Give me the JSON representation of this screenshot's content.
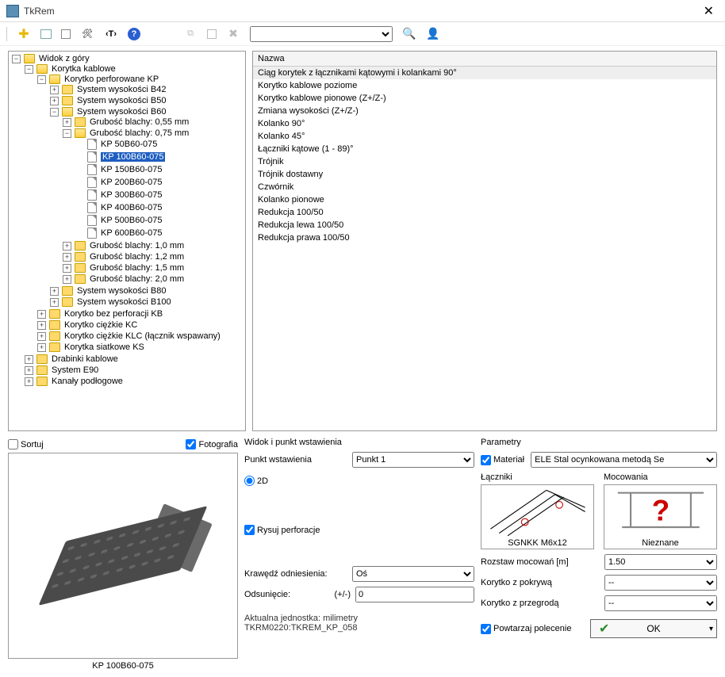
{
  "window": {
    "title": "TkRem"
  },
  "toolbar": {
    "search_value": ""
  },
  "tree": {
    "root_label": "Widok z góry",
    "korytka_label": "Korytka kablowe",
    "kp_label": "Korytko perforowane KP",
    "b42": "System wysokości B42",
    "b50": "System wysokości B50",
    "b60": "System wysokości B60",
    "gb055": "Grubość blachy: 0,55 mm",
    "gb075": "Grubość blachy: 0,75 mm",
    "kp50": "KP 50B60-075",
    "kp100": "KP 100B60-075",
    "kp150": "KP 150B60-075",
    "kp200": "KP 200B60-075",
    "kp300": "KP 300B60-075",
    "kp400": "KP 400B60-075",
    "kp500": "KP 500B60-075",
    "kp600": "KP 600B60-075",
    "gb10": "Grubość blachy: 1,0 mm",
    "gb12": "Grubość blachy: 1,2 mm",
    "gb15": "Grubość blachy: 1,5 mm",
    "gb20": "Grubość blachy: 2,0 mm",
    "b80": "System wysokości B80",
    "b100": "System wysokości B100",
    "kb": "Korytko bez perforacji KB",
    "kc": "Korytko ciężkie KC",
    "klc": "Korytko ciężkie KLC (łącznik wspawany)",
    "ks": "Korytka siatkowe KS",
    "drabinki": "Drabinki kablowe",
    "e90": "System E90",
    "kanaly": "Kanały podłogowe"
  },
  "list": {
    "header": "Nazwa",
    "items": [
      "Ciąg korytek z łącznikami kątowymi i kolankami 90°",
      "Korytko kablowe poziome",
      "Korytko kablowe pionowe (Z+/Z-)",
      "Zmiana wysokości (Z+/Z-)",
      "Kolanko 90°",
      "Kolanko 45°",
      "Łączniki kątowe (1 - 89)°",
      "Trójnik",
      "Trójnik dostawny",
      "Czwórnik",
      "Kolanko pionowe",
      "Redukcja 100/50",
      "Redukcja lewa 100/50",
      "Redukcja prawa 100/50"
    ]
  },
  "preview": {
    "sort_label": "Sortuj",
    "photo_label": "Fotografia",
    "caption": "KP 100B60-075"
  },
  "insert": {
    "title": "Widok i punkt wstawienia",
    "punkt_label": "Punkt wstawienia",
    "punkt_value": "Punkt 1",
    "radio_2d": "2D",
    "rysuj_label": "Rysuj perforacje",
    "krawedz_label": "Krawędź odniesienia:",
    "krawedz_value": "Oś",
    "odsuniecie_label": "Odsunięcie:",
    "odsuniecie_unit": "(+/-)",
    "odsuniecie_value": "0"
  },
  "params": {
    "title": "Parametry",
    "material_label": "Materiał",
    "material_value": "ELE Stal ocynkowana metodą Se",
    "laczniki_label": "Łączniki",
    "mocowania_label": "Mocowania",
    "laczniki_caption": "SGNKK M6x12",
    "mocowania_caption": "Nieznane",
    "rozstaw_label": "Rozstaw mocowań [m]",
    "rozstaw_value": "1.50",
    "pokrywa_label": "Korytko z pokrywą",
    "pokrywa_value": "--",
    "przegroda_label": "Korytko z przegrodą",
    "przegroda_value": "--",
    "powtarzaj_label": "Powtarzaj polecenie",
    "ok_label": "OK"
  },
  "status": {
    "unit_line": "Aktualna jednostka: milimetry",
    "code_line": "TKRM0220:TKREM_KP_058"
  }
}
